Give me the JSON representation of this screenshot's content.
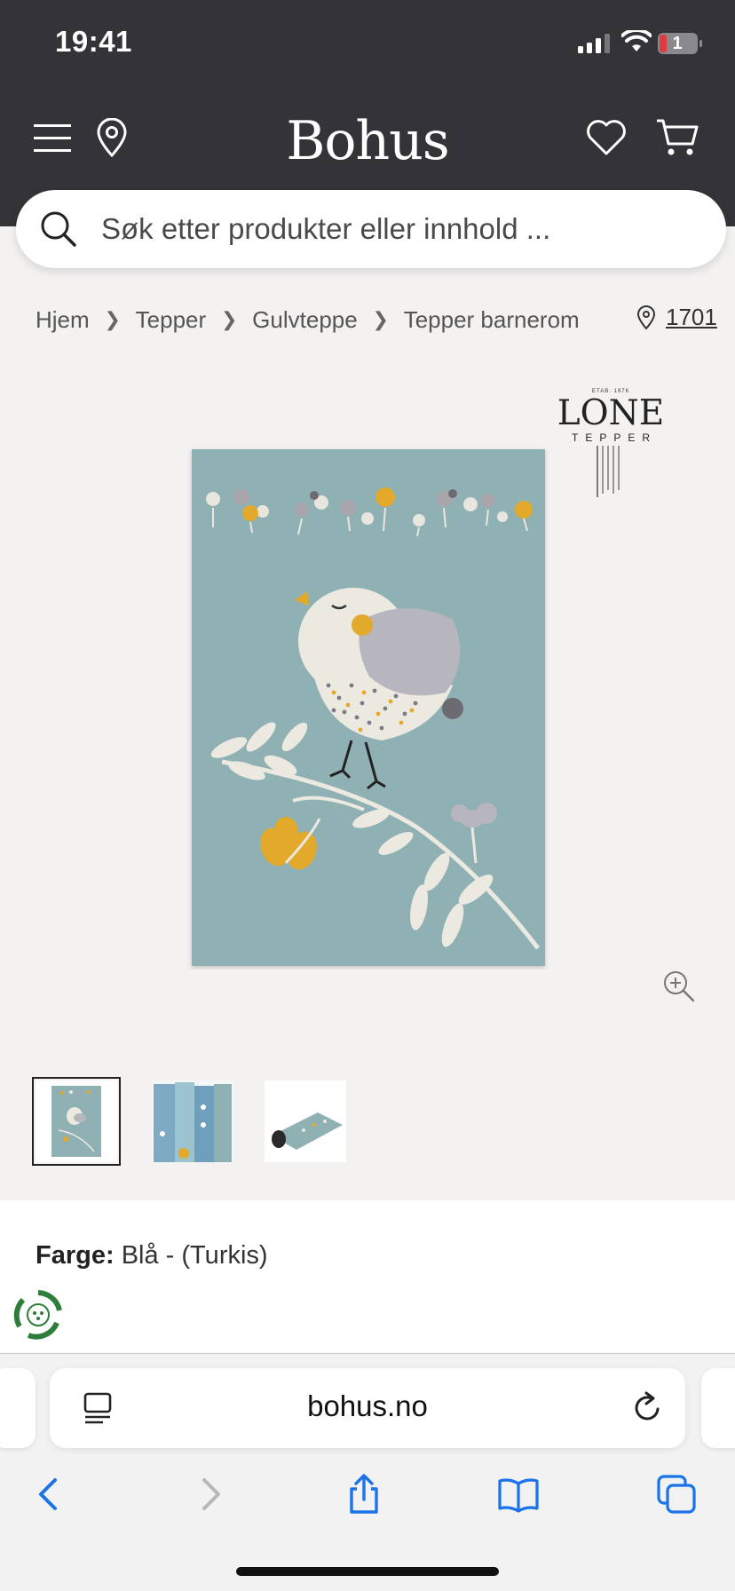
{
  "status_bar": {
    "time": "19:41",
    "battery_level": "1"
  },
  "header": {
    "logo": "Bohus"
  },
  "search": {
    "placeholder": "Søk etter produkter eller innhold ..."
  },
  "breadcrumb": [
    "Hjem",
    "Tepper",
    "Gulvteppe",
    "Tepper barnerom"
  ],
  "store": {
    "code": "1701"
  },
  "brand": {
    "name": "LONE",
    "sub": "TEPPER",
    "established": "ETAB. 1976"
  },
  "thumbnails": {
    "count": 3,
    "selected_index": 0
  },
  "product": {
    "color_label": "Farge:",
    "color_value": "Blå - (Turkis)"
  },
  "browser": {
    "url": "bohus.no"
  },
  "icons": {
    "menu": "hamburger-menu-icon",
    "location": "location-pin-icon",
    "favorite": "heart-icon",
    "cart": "cart-icon",
    "search": "search-icon",
    "zoom": "zoom-in-icon",
    "back": "chevron-left-icon",
    "forward": "chevron-right-icon",
    "share": "share-icon",
    "bookmarks": "book-icon",
    "tabs": "tabs-icon"
  },
  "colors": {
    "header_bg": "#333338",
    "rug_blue": "#8fb1b3",
    "accent_blue": "#1a73e8"
  }
}
